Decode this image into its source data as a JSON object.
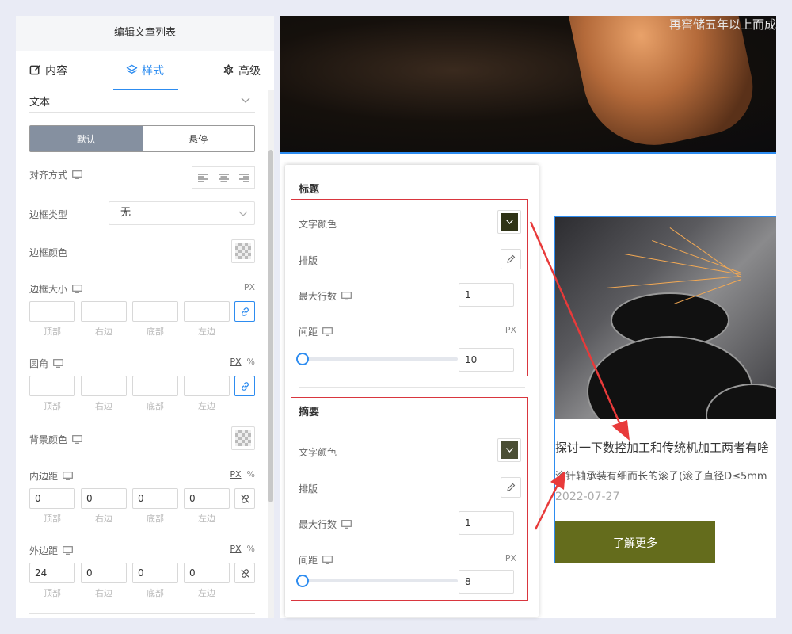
{
  "panel": {
    "title": "编辑文章列表",
    "tabs": [
      {
        "label": "内容",
        "icon": "edit-icon"
      },
      {
        "label": "样式",
        "icon": "layers-icon"
      },
      {
        "label": "高级",
        "icon": "settings-icon"
      }
    ],
    "text_select": "文本",
    "states": {
      "default": "默认",
      "hover": "悬停"
    },
    "align_label": "对齐方式",
    "border_type_label": "边框类型",
    "border_type_value": "无",
    "border_color_label": "边框颜色",
    "border_size_label": "边框大小",
    "radius_label": "圆角",
    "bg_color_label": "背景颜色",
    "padding_label": "内边距",
    "margin_label": "外边距",
    "unit_px": "PX",
    "unit_pct": "%",
    "side_caps": [
      "顶部",
      "右边",
      "底部",
      "左边"
    ],
    "padding_values": [
      "0",
      "0",
      "0",
      "0"
    ],
    "margin_values": [
      "24",
      "0",
      "0",
      "0"
    ]
  },
  "preview": {
    "hero_caption": "再窖储五年以上而成",
    "card_title": "探讨一下数控加工和传统机加工两者有啥",
    "card_summary": "滚针轴承装有细而长的滚子(滚子直径D≤5mm",
    "card_date": "2022-07-27",
    "more_button": "了解更多",
    "button_color": "#646c1c"
  },
  "popup": {
    "title_section": {
      "heading": "标题",
      "text_color_label": "文字颜色",
      "text_color": "#2f3316",
      "typography_label": "排版",
      "max_lines_label": "最大行数",
      "max_lines": "1",
      "spacing_label": "间距",
      "spacing_unit": "PX",
      "spacing_value": "10"
    },
    "summary_section": {
      "heading": "摘要",
      "text_color_label": "文字颜色",
      "text_color": "#4a4e34",
      "typography_label": "排版",
      "max_lines_label": "最大行数",
      "max_lines": "1",
      "spacing_label": "间距",
      "spacing_unit": "PX",
      "spacing_value": "8"
    }
  }
}
